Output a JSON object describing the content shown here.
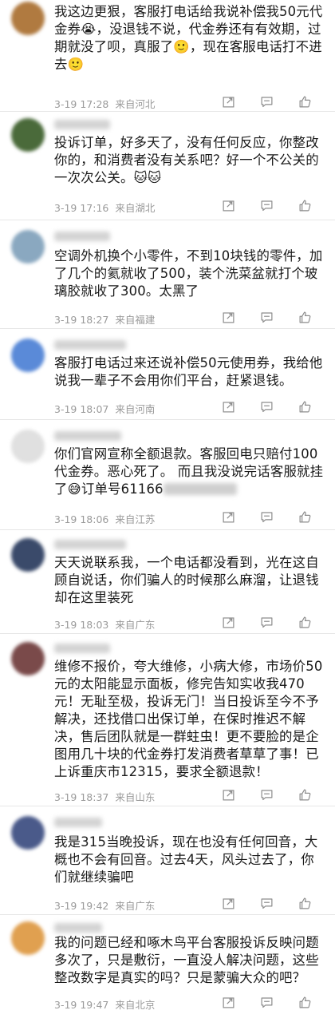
{
  "comments": [
    {
      "avatar_color": "#b07a40",
      "text": "我这边更狠，客服打电话给我说补偿我50元代金券😭，没退钱不说，代金券还有有效期，过期就没了呗，真服了🙂，现在客服电话打不进去🙂",
      "date": "3-19 17:28",
      "location": "来自河北"
    },
    {
      "avatar_color": "#4a6a3a",
      "text": "投诉订单，好多天了，没有任何反应，你整改你的，和消费者没有关系吧？好一个不公关的一次次公关。🐱🐱",
      "date": "3-19 17:16",
      "location": "来自湖北"
    },
    {
      "avatar_color": "#8aa8c0",
      "text": "空调外机换个小零件，不到10块钱的零件，加了几个的氦就收了500，装个洗菜盆就打个玻璃胶就收了300。太黑了",
      "date": "3-19 18:27",
      "location": "来自福建"
    },
    {
      "avatar_color": "#5a8ad8",
      "text": "客服打电话过来还说补偿50元使用券，我给他说我一辈子不会用你们平台，赶紧退钱。",
      "date": "3-19 18:07",
      "location": "来自河南"
    },
    {
      "avatar_color": "#e0e0e0",
      "text_a": "你们官网宣称全额退款。客服回电只赔付100代金券。恶心死了。 而且我没说完话客服就挂了😅订单号61166",
      "date": "3-19 18:06",
      "location": "来自江苏"
    },
    {
      "avatar_color": "#3a4a6a",
      "text": "天天说联系我，一个电话都没看到，光在这自顾自说话，你们骗人的时候那么麻溜，让退钱却在这里装死",
      "date": "3-19 18:03",
      "location": "来自广东"
    },
    {
      "avatar_color": "#7a4a4a",
      "text": "维修不报价，夸大维修，小病大修，市场价50元的太阳能显示面板，修完告知实收我470元！无耻至极，投诉无门！当日投诉至今不予解决，还找借口出保订单，在保时推迟不解决，售后团队就是一群蛀虫！更不要脸的是企图用几十块的代金券打发消费者草草了事！已上诉重庆市12315，要求全额退款！",
      "date": "3-19 18:37",
      "location": "来自山东"
    },
    {
      "avatar_color": "#4a5a8a",
      "text": "我是315当晚投诉，现在也没有任何回音，大概也不会有回音。过去4天，风头过去了，你们就继续骗吧",
      "date": "3-19 19:42",
      "location": "来自广东"
    },
    {
      "avatar_color": "#e0a050",
      "text": "我的问题已经和啄木鸟平台客服投诉反映问题多次了，只是敷衍，一直没人解决问题，这些整改数字是真实的吗？只是蒙骗大众的吧？",
      "date": "3-19 19:47",
      "location": "来自北京"
    }
  ],
  "icons": {
    "share": "share-icon",
    "comment": "comment-icon",
    "like": "thumbs-up-icon"
  }
}
